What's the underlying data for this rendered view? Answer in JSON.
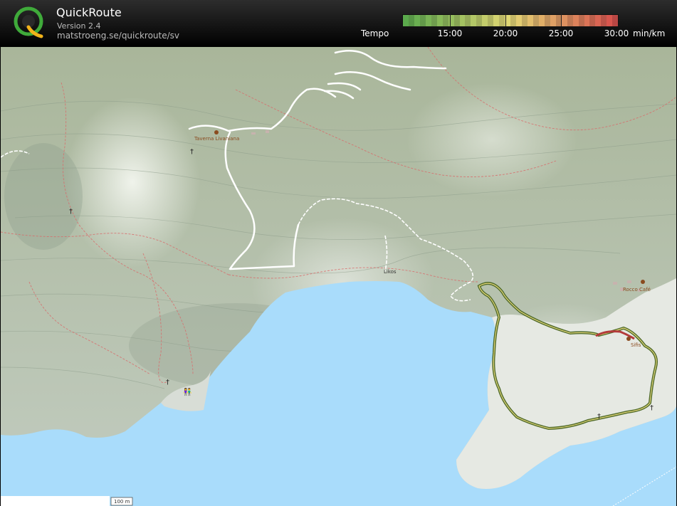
{
  "header": {
    "app_title": "QuickRoute",
    "version": "Version 2.4",
    "website": "matstroeng.se/quickroute/sv",
    "logo_letter": "Q"
  },
  "legend": {
    "label": "Tempo",
    "ticks": [
      "15:00",
      "20:00",
      "25:00",
      "30:00"
    ],
    "unit": "min/km",
    "gradient_from": "#5fb24f",
    "gradient_mid": "#efe27a",
    "gradient_to": "#e2524f"
  },
  "map": {
    "places": {
      "taverna": "Taverna Livaniana",
      "likos": "Likos",
      "cafe": "Rocco Café",
      "sifis": "Sifis"
    },
    "scale_text": "100 m",
    "colors": {
      "sea": "#a9dcfb",
      "terrain": "#b9c7b7",
      "route": "#4f6b2a",
      "trail": "#ffffff",
      "path": "#d96a6a"
    }
  }
}
